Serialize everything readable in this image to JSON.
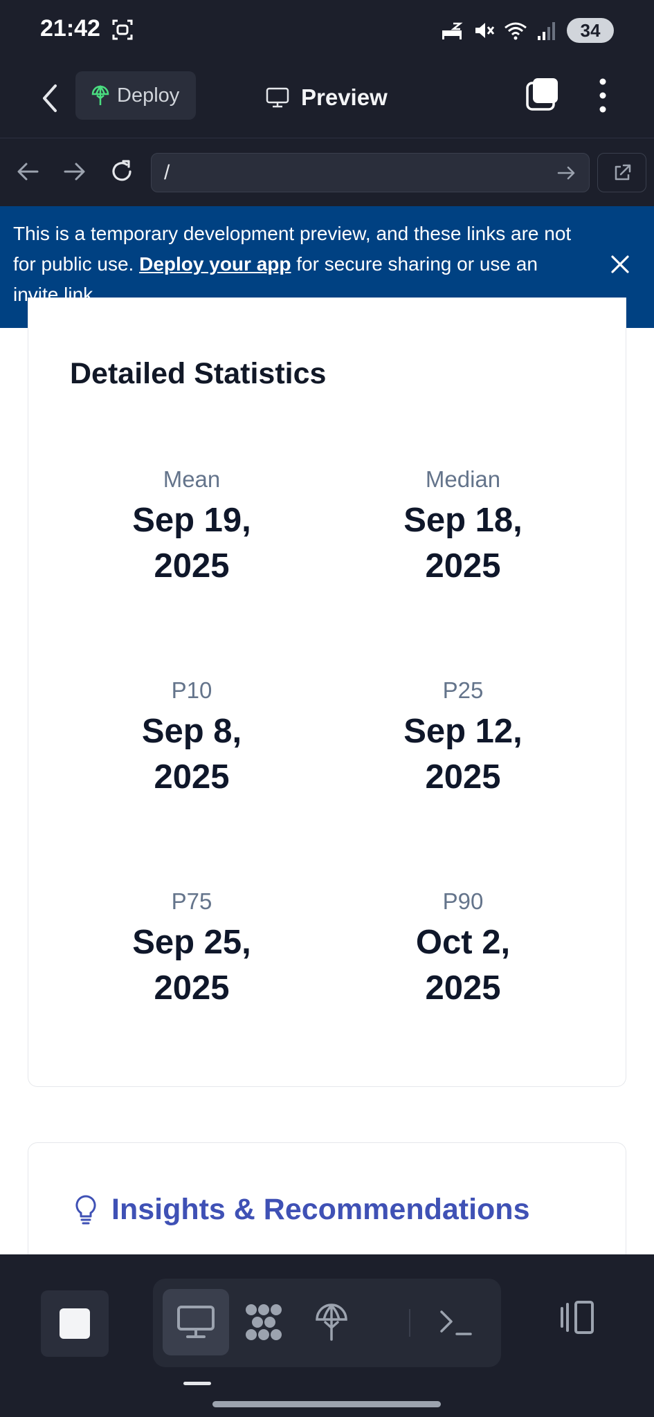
{
  "status_bar": {
    "time": "21:42",
    "battery": "34"
  },
  "app_bar": {
    "deploy_label": "Deploy",
    "preview_label": "Preview"
  },
  "url_bar": {
    "url": "/"
  },
  "banner": {
    "text_before": "This is a temporary development preview, and these links are not for public use.",
    "link": "Deploy your app",
    "text_after": "for secure sharing or use an invite link."
  },
  "stats": {
    "title": "Detailed Statistics",
    "items": [
      {
        "label": "Mean",
        "line1": "Sep 19,",
        "line2": "2025"
      },
      {
        "label": "Median",
        "line1": "Sep 18,",
        "line2": "2025"
      },
      {
        "label": "P10",
        "line1": "Sep 8,",
        "line2": "2025"
      },
      {
        "label": "P25",
        "line1": "Sep 12,",
        "line2": "2025"
      },
      {
        "label": "P75",
        "line1": "Sep 25,",
        "line2": "2025"
      },
      {
        "label": "P90",
        "line1": "Oct 2,",
        "line2": "2025"
      }
    ]
  },
  "insights": {
    "title": "Insights & Recommendations"
  },
  "colors": {
    "chrome_bg": "#1c1f2b",
    "banner_bg": "#004182",
    "insights_accent": "#3f51b5",
    "deploy_icon": "#4ade80"
  }
}
